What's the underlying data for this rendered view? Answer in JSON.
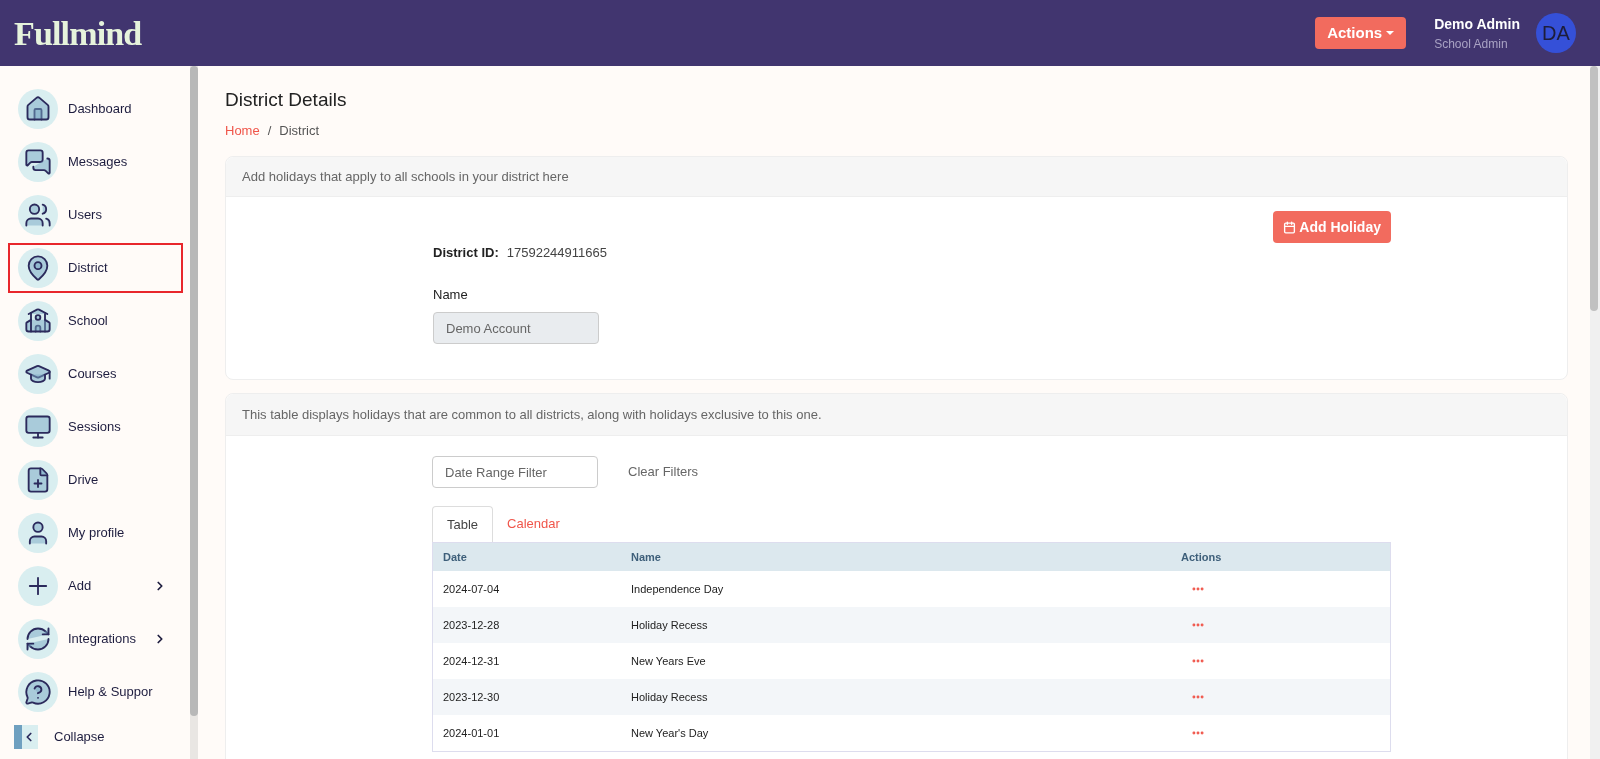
{
  "header": {
    "logo": "Fullmind",
    "actions_button": "Actions",
    "user": {
      "name": "Demo Admin",
      "role": "School Admin",
      "initials": "DA"
    }
  },
  "sidebar": {
    "items": [
      {
        "label": "Dashboard",
        "selected": false,
        "submenu": false
      },
      {
        "label": "Messages",
        "selected": false,
        "submenu": false
      },
      {
        "label": "Users",
        "selected": false,
        "submenu": false
      },
      {
        "label": "District",
        "selected": true,
        "submenu": false
      },
      {
        "label": "School",
        "selected": false,
        "submenu": false
      },
      {
        "label": "Courses",
        "selected": false,
        "submenu": false
      },
      {
        "label": "Sessions",
        "selected": false,
        "submenu": false
      },
      {
        "label": "Drive",
        "selected": false,
        "submenu": false
      },
      {
        "label": "My profile",
        "selected": false,
        "submenu": false
      },
      {
        "label": "Add",
        "selected": false,
        "submenu": true
      },
      {
        "label": "Integrations",
        "selected": false,
        "submenu": true
      },
      {
        "label": "Help & Suppor",
        "selected": false,
        "submenu": false
      }
    ],
    "collapse": "Collapse"
  },
  "page": {
    "title": "District Details",
    "breadcrumb": [
      "Home",
      "District"
    ],
    "breadcrumb_separator": "/"
  },
  "district_card": {
    "header": "Add holidays that apply to all schools in your district here",
    "add_button": "Add Holiday",
    "id_label": "District ID:",
    "id_value": "17592244911665",
    "name_label": "Name",
    "name_value": "Demo Account"
  },
  "holidays_card": {
    "header": "This table displays holidays that are common to all districts, along with holidays exclusive to this one.",
    "filter": {
      "placeholder": "Date Range Filter"
    },
    "clear_filters": "Clear Filters",
    "tabs": [
      {
        "label": "Table",
        "selected": true
      },
      {
        "label": "Calendar",
        "selected": false
      }
    ],
    "table": {
      "columns": [
        "Date",
        "Name",
        "Actions"
      ],
      "rows": [
        {
          "date": "2024-07-04",
          "name": "Independence Day"
        },
        {
          "date": "2023-12-28",
          "name": "Holiday Recess"
        },
        {
          "date": "2024-12-31",
          "name": "New Years Eve"
        },
        {
          "date": "2023-12-30",
          "name": "Holiday Recess"
        },
        {
          "date": "2024-01-01",
          "name": "New Year's Day"
        }
      ]
    }
  }
}
